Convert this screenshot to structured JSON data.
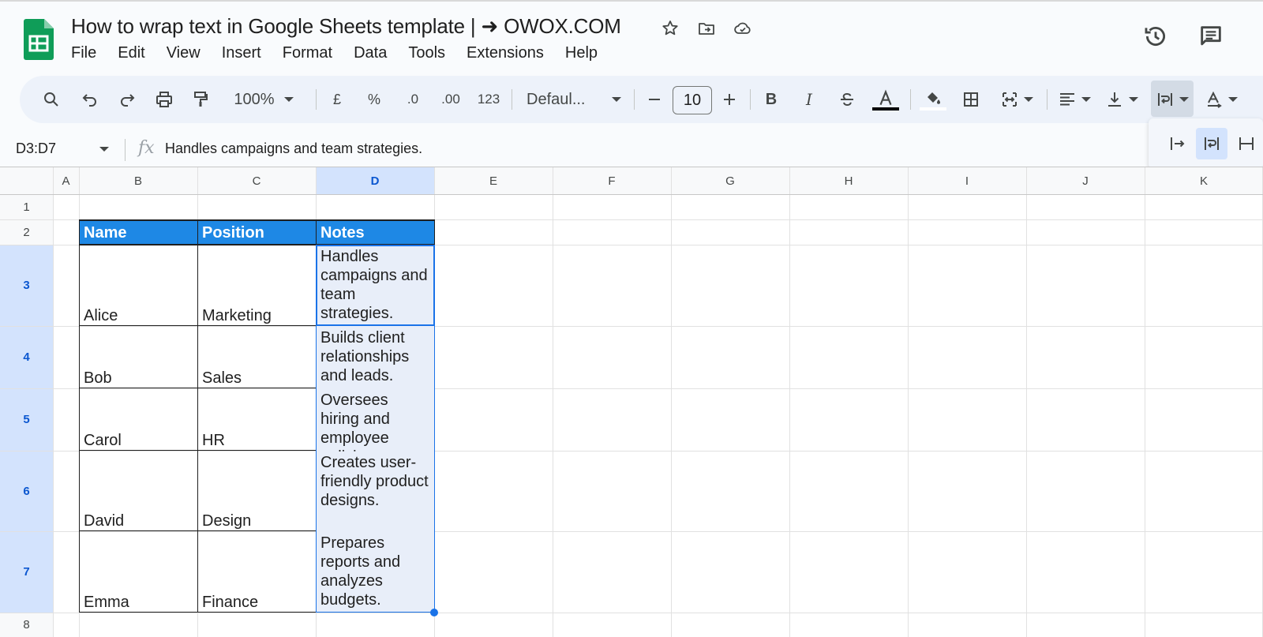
{
  "app": {
    "title": "How to wrap text in Google Sheets template | ➜ OWOX.COM",
    "menu": [
      "File",
      "Edit",
      "View",
      "Insert",
      "Format",
      "Data",
      "Tools",
      "Extensions",
      "Help"
    ]
  },
  "toolbar": {
    "zoom": "100%",
    "currency": "£",
    "percent": "%",
    "decrease_decimal": ".0",
    "increase_decimal": ".00",
    "number_format": "123",
    "font": "Defaul...",
    "font_size": "10",
    "bold": "B",
    "italic": "I"
  },
  "formula_bar": {
    "name_box": "D3:D7",
    "fx": "fx",
    "content": "Handles campaigns and team strategies."
  },
  "columns": [
    "A",
    "B",
    "C",
    "D",
    "E",
    "F",
    "G",
    "H",
    "I",
    "J",
    "K"
  ],
  "rows": [
    "1",
    "2",
    "3",
    "4",
    "5",
    "6",
    "7",
    "8"
  ],
  "table": {
    "headers": [
      "Name",
      "Position",
      "Notes"
    ],
    "rows": [
      {
        "name": "Alice",
        "position": "Marketing",
        "notes": "Handles campaigns and team strategies."
      },
      {
        "name": "Bob",
        "position": "Sales",
        "notes": "Builds client relationships and leads."
      },
      {
        "name": "Carol",
        "position": "HR",
        "notes": "Oversees hiring and employee policies."
      },
      {
        "name": "David",
        "position": "Design",
        "notes": "Creates user-friendly product designs."
      },
      {
        "name": "Emma",
        "position": "Finance",
        "notes": "Prepares reports and analyzes budgets."
      }
    ]
  },
  "colors": {
    "header_fill": "#1e88e5",
    "selection_fill": "#e8eef9",
    "selection_border": "#1a73e8",
    "toolbar_bg": "#edf2fa"
  }
}
